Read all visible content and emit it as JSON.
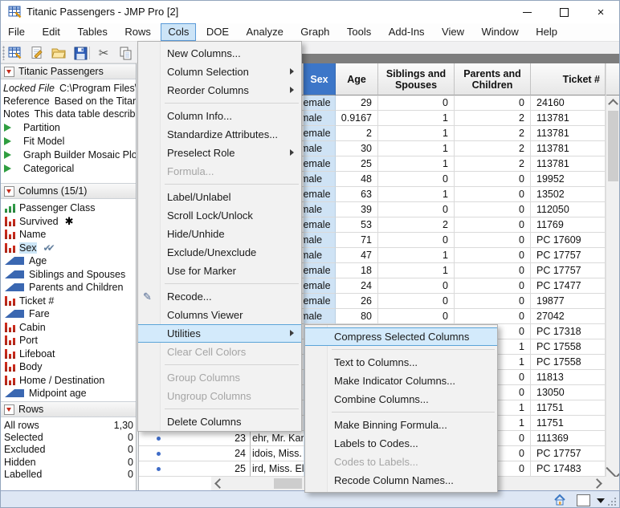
{
  "window": {
    "title": "Titanic Passengers - JMP Pro [2]",
    "controls": [
      "minimize",
      "maximize",
      "close"
    ]
  },
  "menubar": {
    "items": [
      {
        "label": "File"
      },
      {
        "label": "Edit"
      },
      {
        "label": "Tables"
      },
      {
        "label": "Rows"
      },
      {
        "label": "Cols",
        "cls": "active"
      },
      {
        "label": "DOE"
      },
      {
        "label": "Analyze"
      },
      {
        "label": "Graph"
      },
      {
        "label": "Tools"
      },
      {
        "label": "Add-Ins"
      },
      {
        "label": "View"
      },
      {
        "label": "Window"
      },
      {
        "label": "Help"
      }
    ]
  },
  "toolbar": {
    "icons": [
      "new-data-table",
      "new-journal",
      "open-file",
      "save-file",
      "cut",
      "copy",
      "paste"
    ]
  },
  "side": {
    "table": {
      "title": "Titanic Passengers",
      "props": [
        {
          "label": "Locked File",
          "value": "C:\\Program Files\\",
          "cls": "italic"
        },
        {
          "label": "Reference",
          "value": "Based on the Titan"
        },
        {
          "label": "Notes",
          "value": "This data table describ"
        }
      ],
      "scripts": [
        "Partition",
        "Fit Model",
        "Graph Builder Mosaic Plo",
        "Categorical"
      ]
    },
    "columns": {
      "title": "Columns (15/1)",
      "items": [
        {
          "label": "Passenger Class",
          "type": "ordinal"
        },
        {
          "label": "Survived",
          "type": "nominal",
          "badge": "✱",
          "badge_cls": "star"
        },
        {
          "label": "Name",
          "type": "nominal"
        },
        {
          "label": "Sex",
          "type": "nominal",
          "cls": "selected",
          "badge": "✔✔",
          "badge_cls": "check"
        },
        {
          "label": "Age",
          "type": "continuous"
        },
        {
          "label": "Siblings and Spouses",
          "type": "continuous"
        },
        {
          "label": "Parents and Children",
          "type": "continuous"
        },
        {
          "label": "Ticket #",
          "type": "nominal"
        },
        {
          "label": "Fare",
          "type": "continuous"
        },
        {
          "label": "Cabin",
          "type": "nominal"
        },
        {
          "label": "Port",
          "type": "nominal"
        },
        {
          "label": "Lifeboat",
          "type": "nominal"
        },
        {
          "label": "Body",
          "type": "nominal"
        },
        {
          "label": "Home / Destination",
          "type": "nominal"
        },
        {
          "label": "Midpoint age",
          "type": "continuous"
        }
      ]
    },
    "rows": {
      "title": "Rows",
      "stats": [
        {
          "label": "All rows",
          "value": "1,30"
        },
        {
          "label": "Selected",
          "value": "0"
        },
        {
          "label": "Excluded",
          "value": "0"
        },
        {
          "label": "Hidden",
          "value": "0"
        },
        {
          "label": "Labelled",
          "value": "0"
        }
      ]
    }
  },
  "grid": {
    "headers": [
      {
        "label": "Sex",
        "cls": "selected"
      },
      {
        "label": "Age"
      },
      {
        "label": "Siblings and\nSpouses"
      },
      {
        "label": "Parents and\nChildren"
      },
      {
        "label": "Ticket #"
      }
    ],
    "rows": [
      {
        "sex": "female",
        "age": "29",
        "sib": "0",
        "par": "0",
        "ticket": "24160"
      },
      {
        "sex": "male",
        "age": "0.9167",
        "sib": "1",
        "par": "2",
        "ticket": "113781"
      },
      {
        "sex": "female",
        "age": "2",
        "sib": "1",
        "par": "2",
        "ticket": "113781"
      },
      {
        "sex": "male",
        "age": "30",
        "sib": "1",
        "par": "2",
        "ticket": "113781"
      },
      {
        "sex": "female",
        "age": "25",
        "sib": "1",
        "par": "2",
        "ticket": "113781"
      },
      {
        "sex": "male",
        "age": "48",
        "sib": "0",
        "par": "0",
        "ticket": "19952"
      },
      {
        "sex": "female",
        "age": "63",
        "sib": "1",
        "par": "0",
        "ticket": "13502"
      },
      {
        "sex": "male",
        "age": "39",
        "sib": "0",
        "par": "0",
        "ticket": "112050"
      },
      {
        "sex": "female",
        "age": "53",
        "sib": "2",
        "par": "0",
        "ticket": "11769"
      },
      {
        "sex": "male",
        "age": "71",
        "sib": "0",
        "par": "0",
        "ticket": "PC 17609"
      },
      {
        "sex": "male",
        "age": "47",
        "sib": "1",
        "par": "0",
        "ticket": "PC 17757"
      },
      {
        "sex": "female",
        "age": "18",
        "sib": "1",
        "par": "0",
        "ticket": "PC 17757"
      },
      {
        "sex": "female",
        "age": "24",
        "sib": "0",
        "par": "0",
        "ticket": "PC 17477"
      },
      {
        "sex": "female",
        "age": "26",
        "sib": "0",
        "par": "0",
        "ticket": "19877"
      },
      {
        "sex": "male",
        "age": "80",
        "sib": "0",
        "par": "0",
        "ticket": "27042"
      },
      {
        "par": "0",
        "ticket": "PC 17318"
      },
      {
        "par": "1",
        "ticket": "PC 17558"
      },
      {
        "par": "1",
        "ticket": "PC 17558"
      },
      {
        "par": "0",
        "ticket": "11813"
      },
      {
        "par": "0",
        "ticket": "13050"
      },
      {
        "par": "1",
        "ticket": "11751"
      },
      {
        "par": "1",
        "ticket": "11751"
      },
      {
        "num": "23",
        "name": "ehr, Mr. Karl Ho...",
        "par": "0",
        "ticket": "111369",
        "cls": "marked"
      },
      {
        "num": "24",
        "name": "idois, Miss. Rosa...",
        "par": "0",
        "ticket": "PC 17757",
        "cls": "marked"
      },
      {
        "num": "25",
        "name": "ird, Miss. Ellen",
        "par": "0",
        "ticket": "PC 17483",
        "cls": "marked"
      }
    ]
  },
  "cols_menu": {
    "items": [
      {
        "label": "New Columns...",
        "cls": "normal"
      },
      {
        "label": "Column Selection",
        "cls": "has-arrow"
      },
      {
        "label": "Reorder Columns",
        "cls": "has-arrow"
      },
      {
        "cls": "sep"
      },
      {
        "label": "Column Info...",
        "cls": "normal"
      },
      {
        "label": "Standardize Attributes...",
        "cls": "normal"
      },
      {
        "label": "Preselect Role",
        "cls": "has-arrow"
      },
      {
        "label": "Formula...",
        "cls": "disabled"
      },
      {
        "cls": "sep"
      },
      {
        "label": "Label/Unlabel",
        "cls": "normal"
      },
      {
        "label": "Scroll Lock/Unlock",
        "cls": "normal"
      },
      {
        "label": "Hide/Unhide",
        "cls": "normal"
      },
      {
        "label": "Exclude/Unexclude",
        "cls": "normal"
      },
      {
        "label": "Use for Marker",
        "cls": "normal"
      },
      {
        "cls": "sep"
      },
      {
        "label": "Recode...",
        "cls": "normal icon-recode"
      },
      {
        "label": "Columns Viewer",
        "cls": "normal"
      },
      {
        "label": "Utilities",
        "cls": "has-arrow highlight"
      },
      {
        "label": "Clear Cell Colors",
        "cls": "disabled"
      },
      {
        "cls": "sep"
      },
      {
        "label": "Group Columns",
        "cls": "disabled"
      },
      {
        "label": "Ungroup Columns",
        "cls": "disabled"
      },
      {
        "cls": "sep"
      },
      {
        "label": "Delete Columns",
        "cls": "normal"
      }
    ]
  },
  "utilities_submenu": {
    "items": [
      {
        "label": "Compress Selected Columns",
        "cls": "highlight"
      },
      {
        "cls": "sep"
      },
      {
        "label": "Text to Columns...",
        "cls": "normal"
      },
      {
        "label": "Make Indicator Columns...",
        "cls": "normal"
      },
      {
        "label": "Combine Columns...",
        "cls": "normal"
      },
      {
        "cls": "sep"
      },
      {
        "label": "Make Binning Formula...",
        "cls": "normal"
      },
      {
        "label": "Labels to Codes...",
        "cls": "normal"
      },
      {
        "label": "Codes to Labels...",
        "cls": "disabled"
      },
      {
        "label": "Recode Column Names...",
        "cls": "normal"
      }
    ]
  },
  "statusbar": {
    "icons": [
      "home",
      "marker-swatch",
      "marker-dropdown",
      "resize-grip"
    ]
  },
  "colors": {
    "selected_header_bg": "#3c76c8",
    "selected_cell_bg": "#cfe3f5",
    "menu_highlight_bg": "#d3eafb",
    "menu_highlight_border": "#5ba4d8",
    "nominal_icon": "#d22d1e",
    "ordinal_icon": "#35a14a",
    "continuous_icon": "#3a67b1",
    "statusbar_bg": "#dee7f4",
    "grid_topstrip": "#7d7d7d"
  }
}
